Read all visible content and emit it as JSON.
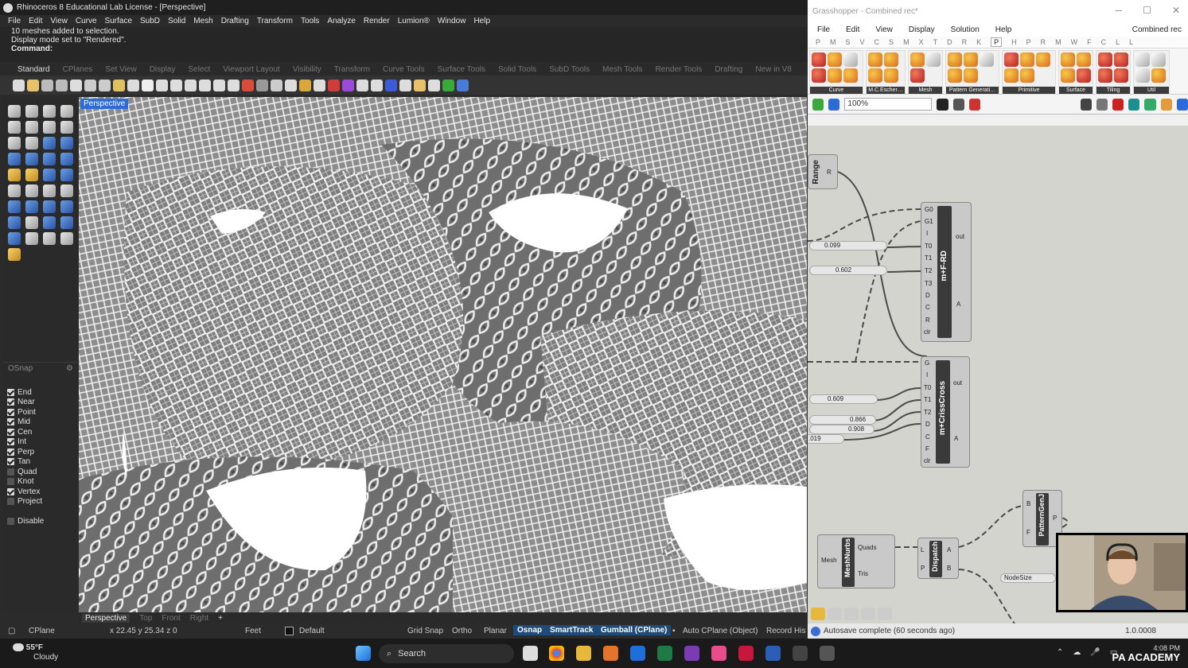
{
  "rhino": {
    "title": "Rhinoceros 8 Educational Lab License - [Perspective]",
    "menu": [
      "File",
      "Edit",
      "View",
      "Curve",
      "Surface",
      "SubD",
      "Solid",
      "Mesh",
      "Drafting",
      "Transform",
      "Tools",
      "Analyze",
      "Render",
      "Lumion®",
      "Window",
      "Help"
    ],
    "history": [
      "10 meshes added to selection.",
      "Display mode set to \"Rendered\"."
    ],
    "command_label": "Command:",
    "tabs": [
      "Standard",
      "CPlanes",
      "Set View",
      "Display",
      "Select",
      "Viewport Layout",
      "Visibility",
      "Transform",
      "Curve Tools",
      "Surface Tools",
      "Solid Tools",
      "SubD Tools",
      "Mesh Tools",
      "Render Tools",
      "Drafting",
      "New in V8"
    ],
    "viewport_label": "Perspective",
    "viewport_tabs": [
      "Perspective",
      "Top",
      "Front",
      "Right"
    ],
    "osnap": {
      "title": "OSnap",
      "items": [
        {
          "label": "End",
          "checked": true
        },
        {
          "label": "Near",
          "checked": true
        },
        {
          "label": "Point",
          "checked": true
        },
        {
          "label": "Mid",
          "checked": true
        },
        {
          "label": "Cen",
          "checked": true
        },
        {
          "label": "Int",
          "checked": true
        },
        {
          "label": "Perp",
          "checked": true
        },
        {
          "label": "Tan",
          "checked": true
        },
        {
          "label": "Quad",
          "checked": false
        },
        {
          "label": "Knot",
          "checked": false
        },
        {
          "label": "Vertex",
          "checked": true
        },
        {
          "label": "Project",
          "checked": false
        }
      ],
      "disable": "Disable"
    },
    "status": {
      "cplane": "CPlane",
      "coords": "x 22.45  y 25.34  z 0",
      "units": "Feet",
      "layer": "Default",
      "grid_snap": "Grid Snap",
      "ortho": "Ortho",
      "planar": "Planar",
      "osnap": "Osnap",
      "smarttrack": "SmartTrack",
      "gumball": "Gumball (CPlane)",
      "autocplane": "Auto CPlane (Object)",
      "record": "Record Hist"
    }
  },
  "grasshopper": {
    "title": "Grasshopper - Combined rec*",
    "menu": [
      "File",
      "Edit",
      "View",
      "Display",
      "Solution",
      "Help"
    ],
    "doc_name": "Combined rec",
    "tabs": [
      "P",
      "M",
      "S",
      "V",
      "C",
      "S",
      "M",
      "X",
      "T",
      "D",
      "R",
      "K",
      "P",
      "H",
      "P",
      "R",
      "M",
      "W",
      "F",
      "C",
      "L",
      "L"
    ],
    "ribbon_groups": [
      "Curve",
      "M.C.Escher…",
      "Mesh",
      "Pattern Generati…",
      "Primitive",
      "Surface",
      "Tiling",
      "Util"
    ],
    "zoom": "100%",
    "components": {
      "range": {
        "label": "Range",
        "out": "R"
      },
      "frd": {
        "label": "m+F-RD",
        "inputs": [
          "G0",
          "G1",
          "I",
          "T0",
          "T1",
          "T2",
          "T3",
          "D",
          "C",
          "R",
          "clr"
        ],
        "outputs": [
          "out",
          "A"
        ]
      },
      "criss": {
        "label": "m+CrissCross",
        "inputs": [
          "G",
          "I",
          "T0",
          "T1",
          "T2",
          "D",
          "C",
          "F",
          "clr"
        ],
        "outputs": [
          "out",
          "A"
        ]
      },
      "meshnurbs": {
        "label": "MeshNurbs",
        "input": "Mesh",
        "outputs": [
          "Quads",
          "Tris"
        ]
      },
      "dispatch": {
        "label": "Dispatch",
        "inputs": [
          "L",
          "P"
        ],
        "outputs": [
          "A",
          "B"
        ]
      },
      "patterngen": {
        "label": "PatternGenJ",
        "inputs": [
          "B",
          "F"
        ],
        "output": "P"
      },
      "nodesize": "NodeSize"
    },
    "sliders": {
      "s1": "0.099",
      "s2": "0.602",
      "s3": "0.609",
      "s4": "0.866",
      "s5": "0.908",
      "s6": ".019"
    },
    "status": "Autosave complete (60 seconds ago)",
    "version": "1.0.0008"
  },
  "taskbar": {
    "temp": "55°F",
    "weather": "Cloudy",
    "search": "Search",
    "time": "4:08 PM",
    "watermark": "PA ACADEMY"
  }
}
